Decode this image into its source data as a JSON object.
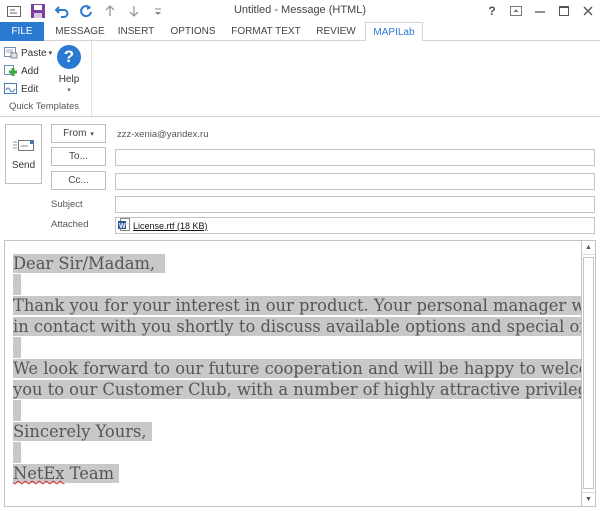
{
  "window": {
    "title": "Untitled - Message (HTML)",
    "controls": {
      "help": "?",
      "restore_ribbon": "ribbon-display-options",
      "minimize": "–",
      "maximize": "□",
      "close": "✕"
    }
  },
  "quick_access": [
    "message-icon",
    "save-icon",
    "undo-icon",
    "redo-icon",
    "up-arrow-icon",
    "down-arrow-icon",
    "customize-icon"
  ],
  "tabs": [
    {
      "label": "FILE"
    },
    {
      "label": "MESSAGE"
    },
    {
      "label": "INSERT"
    },
    {
      "label": "OPTIONS"
    },
    {
      "label": "FORMAT TEXT"
    },
    {
      "label": "REVIEW"
    },
    {
      "label": "MAPILab",
      "active": true
    }
  ],
  "ribbon": {
    "group_label": "Quick Templates",
    "paste_label": "Paste",
    "add_label": "Add",
    "edit_label": "Edit",
    "help_label": "Help",
    "help_glyph": "?"
  },
  "header": {
    "send_label": "Send",
    "from_label": "From",
    "from_caret": "▾",
    "from_value": "zzz-xenia@yandex.ru",
    "to_label": "To...",
    "to_value": "",
    "cc_label": "Cc...",
    "cc_value": "",
    "subject_label": "Subject",
    "subject_value": "",
    "attached_label": "Attached",
    "attachment": "License.rtf (18 KB)"
  },
  "body": {
    "greeting": "Dear Sir/Madam,",
    "p1_line1": "Thank you for your interest in our product. Your personal manager will be",
    "p1_line2": "in contact with you shortly to discuss available options and special offers.",
    "p2_line1": "We look forward to our future cooperation and will be happy to welcome",
    "p2_line2": "you to our Customer Club, with a number of highly attractive privileges.",
    "closing": "Sincerely Yours,",
    "signature_misspelled": "NetEx",
    "signature_rest": " Team"
  },
  "colors": {
    "accent": "#2b7ad1",
    "highlight": "#c8c8c8",
    "save_icon": "#7b3f9e"
  }
}
